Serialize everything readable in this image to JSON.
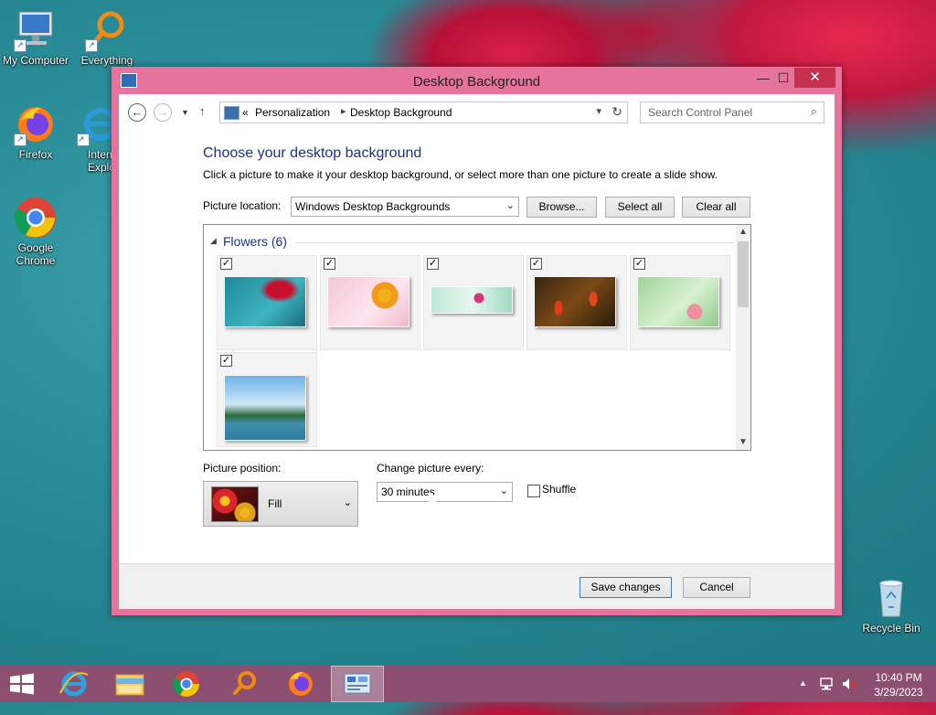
{
  "desktop": {
    "icons": [
      {
        "label": "My Computer"
      },
      {
        "label": "Everything"
      },
      {
        "label": "Firefox"
      },
      {
        "label": "Internet Explorer",
        "visible_text": "Intern Explo"
      },
      {
        "label": "Google Chrome"
      },
      {
        "label": "Recycle Bin"
      }
    ]
  },
  "window": {
    "title": "Desktop Background",
    "controls": {
      "minimize": "—",
      "maximize": "☐",
      "close": "✕"
    },
    "nav": {
      "breadcrumb": [
        "Personalization",
        "Desktop Background"
      ],
      "separator": "«",
      "search_placeholder": "Search Control Panel"
    },
    "heading": "Choose your desktop background",
    "description": "Click a picture to make it your desktop background, or select more than one picture to create a slide show.",
    "picture_location": {
      "label": "Picture location:",
      "value": "Windows Desktop Backgrounds",
      "buttons": {
        "browse": "Browse...",
        "select_all": "Select all",
        "clear_all": "Clear all"
      }
    },
    "gallery": {
      "group": "Flowers (6)",
      "group_expander": "◢",
      "tiles": [
        {
          "checked": true,
          "subject": "red flower on teal"
        },
        {
          "checked": true,
          "subject": "orange flower on pink"
        },
        {
          "checked": true,
          "subject": "pink flower on mint"
        },
        {
          "checked": true,
          "subject": "red flowers on dark"
        },
        {
          "checked": true,
          "subject": "pink lily on green"
        },
        {
          "checked": true,
          "subject": "lake and mountains"
        }
      ]
    },
    "picture_position": {
      "label": "Picture position:",
      "value": "Fill"
    },
    "change_picture": {
      "label": "Change picture every:",
      "value": "30 minutes"
    },
    "shuffle": {
      "label": "Shuffle",
      "checked": false
    },
    "footer": {
      "save": "Save changes",
      "cancel": "Cancel"
    }
  },
  "taskbar": {
    "apps": [
      "start",
      "internet-explorer",
      "file-explorer",
      "google-chrome",
      "everything",
      "firefox",
      "control-panel"
    ],
    "active_app": "control-panel",
    "clock": {
      "time": "10:40 PM",
      "date": "3/29/2023"
    }
  },
  "colors": {
    "window_border": "#e5739b",
    "close_button": "#c7304d",
    "heading": "#1e3287",
    "taskbar": "#964b6e"
  }
}
